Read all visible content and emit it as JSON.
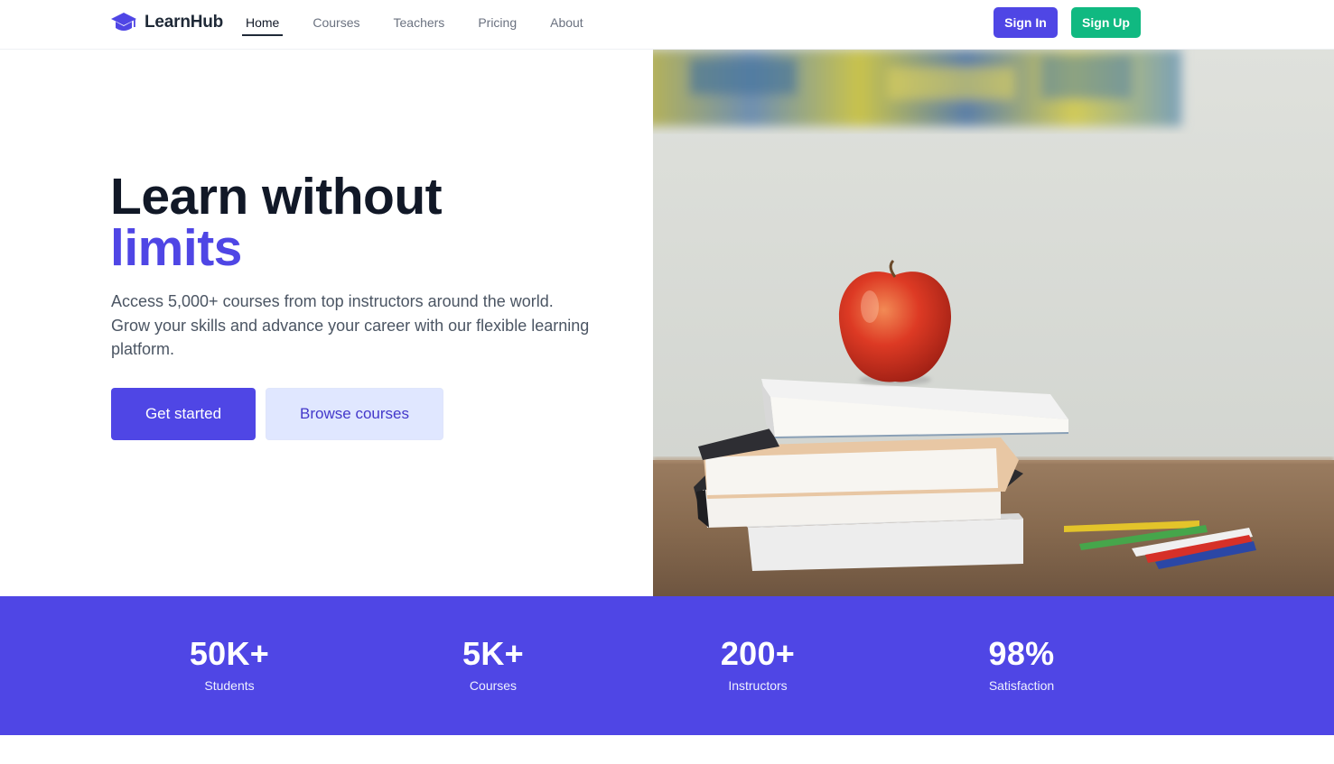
{
  "brand": {
    "name": "LearnHub",
    "icon": "graduation-cap-icon",
    "color": "#4f46e5"
  },
  "nav": {
    "links": [
      {
        "label": "Home",
        "active": true
      },
      {
        "label": "Courses",
        "active": false
      },
      {
        "label": "Teachers",
        "active": false
      },
      {
        "label": "Pricing",
        "active": false
      },
      {
        "label": "About",
        "active": false
      }
    ],
    "sign_in": "Sign In",
    "sign_up": "Sign Up"
  },
  "hero": {
    "title_line1": "Learn without",
    "title_line2": "limits",
    "description": "Access 5,000+ courses from top instructors around the world. Grow your skills and advance your career with our flexible learning platform.",
    "primary_cta": "Get started",
    "secondary_cta": "Browse courses",
    "image_subject": "apple-on-books-with-pencils"
  },
  "stats": [
    {
      "value": "50K+",
      "label": "Students"
    },
    {
      "value": "5K+",
      "label": "Courses"
    },
    {
      "value": "200+",
      "label": "Instructors"
    },
    {
      "value": "98%",
      "label": "Satisfaction"
    }
  ],
  "colors": {
    "primary": "#4f46e5",
    "success": "#10b981",
    "secondary_bg": "#e0e7ff",
    "heading": "#111827",
    "body_text": "#4b5563"
  }
}
